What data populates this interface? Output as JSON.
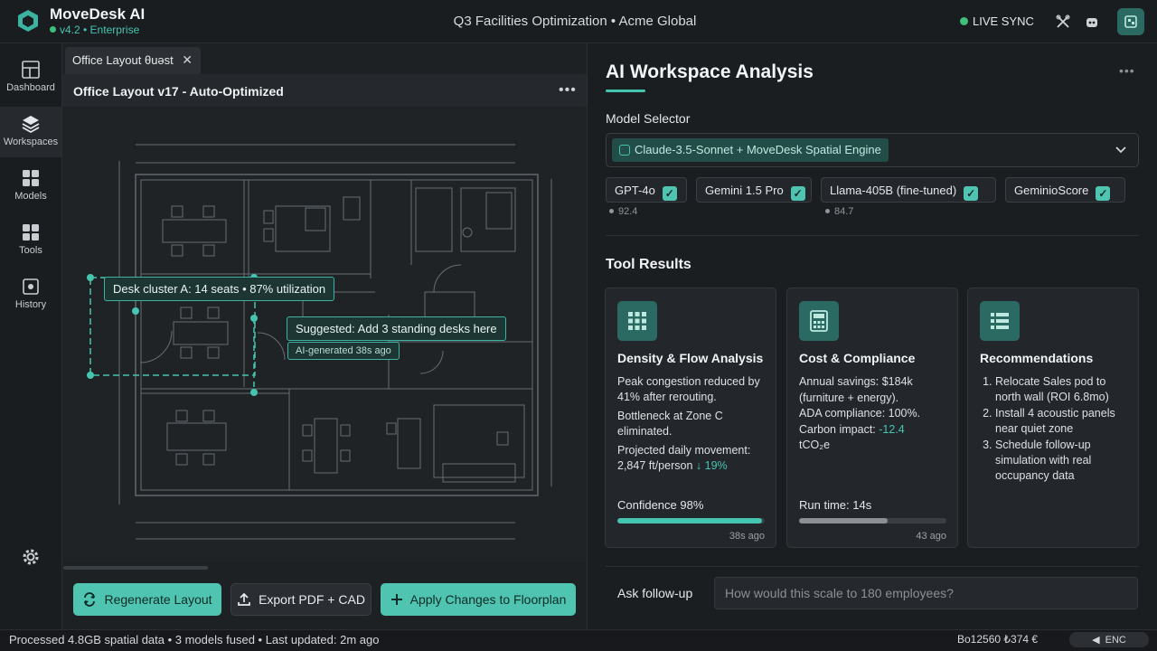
{
  "app": {
    "title": "MoveDesk AI",
    "version": "v4.2 • Enterprise",
    "project_title": "Q3 Facilities Optimization • Acme Global",
    "live_sync": "LIVE SYNC",
    "accent_color": "#45c4b0"
  },
  "sidebar": {
    "items": [
      {
        "label": "Dashboard",
        "icon": "layout-icon"
      },
      {
        "label": "Workspaces",
        "icon": "layers-icon"
      },
      {
        "label": "Models",
        "icon": "grid-icon"
      },
      {
        "label": "Tools",
        "icon": "tools-icon"
      },
      {
        "label": "History",
        "icon": "history-icon"
      }
    ],
    "settings_icon": "gear-icon"
  },
  "left_panel": {
    "tab_label": "Office Layout θuəst",
    "plan_title": "Office Layout v17 - Auto-Optimized",
    "callouts": {
      "desk_cluster": "Desk cluster A: 14 seats • 87% utilization",
      "suggestion": "Suggested: Add 3 standing desks here",
      "ai_generated": "AI-generated 38s ago"
    },
    "actions": {
      "regenerate": "Regenerate Layout",
      "export": "Export PDF + CAD",
      "apply": "Apply Changes to Floorplan"
    }
  },
  "right_panel": {
    "title": "AI Workspace Analysis",
    "model_selector_label": "Model Selector",
    "selected_model": "Claude-3.5-Sonnet + MoveDesk Spatial Engine",
    "model_options": [
      {
        "label": "GPT-4o",
        "checked": true,
        "score": "92.4"
      },
      {
        "label": "Gemini 1.5 Pro",
        "checked": true
      },
      {
        "label": "Llama-405B (fine-tuned)",
        "checked": true,
        "score": "84.7"
      },
      {
        "label": "GeminioScore",
        "checked": true
      }
    ],
    "tool_results_title": "Tool Results",
    "cards": {
      "density": {
        "title": "Density & Flow Analysis",
        "p1": "Peak congestion reduced by 41% after rerouting.",
        "p2": "Bottleneck at Zone C eliminated.",
        "p3_prefix": "Projected daily movement: 2,847 ft/person",
        "p3_delta": "↓ 19%",
        "metric": "Confidence 98%",
        "confidence": 0.98,
        "ago": "38s ago"
      },
      "cost": {
        "title": "Cost & Compliance",
        "p1": "Annual savings: $184k (furniture + energy).",
        "p2": "ADA compliance: 100%.",
        "p3_prefix": "Carbon impact:",
        "p3_value": "-12.4",
        "p3_suffix": "tCO₂e",
        "metric": "Run time: 14s",
        "progress": 0.6,
        "ago": "43 ago"
      },
      "recommendations": {
        "title": "Recommendations",
        "items": [
          "Relocate Sales pod to north wall (ROI 6.8mo)",
          "Install 4 acoustic panels near quiet zone",
          "Schedule follow-up simulation with real occupancy data"
        ]
      }
    },
    "followup": {
      "label": "Ask follow-up",
      "placeholder": "How would this scale to 180 employees?"
    }
  },
  "footer": {
    "status": "Processed 4.8GB spatial data • 3 models fused • Last updated: 2m ago",
    "coords": "Bo12560 ₺374 €",
    "sync_label": "ENC"
  }
}
